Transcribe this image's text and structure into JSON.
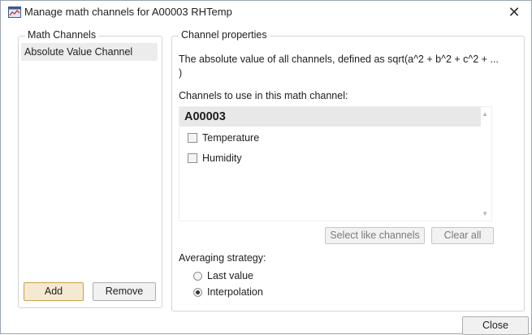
{
  "window": {
    "title": "Manage math channels for A00003 RHTemp",
    "close_glyph": "✕"
  },
  "math_channels": {
    "legend": "Math Channels",
    "items": [
      {
        "label": "Absolute Value Channel",
        "selected": true
      }
    ],
    "add_label": "Add",
    "remove_label": "Remove"
  },
  "channel_properties": {
    "legend": "Channel properties",
    "description": "The absolute value of all channels, defined as sqrt(a^2 + b^2 + c^2 + ... )",
    "channels_label": "Channels to use in this math channel:",
    "device_group": "A00003",
    "channels": [
      {
        "label": "Temperature",
        "checked": false
      },
      {
        "label": "Humidity",
        "checked": false
      }
    ],
    "select_like_label": "Select like channels",
    "clear_all_label": "Clear all",
    "averaging_label": "Averaging strategy:",
    "averaging_options": [
      {
        "label": "Last value",
        "selected": false
      },
      {
        "label": "Interpolation",
        "selected": true
      }
    ]
  },
  "footer": {
    "close_label": "Close"
  },
  "icons": {
    "app": "chart-window-icon",
    "close": "close-icon",
    "scroll_up": "scroll-up-arrow-icon",
    "scroll_down": "scroll-down-arrow-icon"
  },
  "colors": {
    "add_button_border": "#c9a24a",
    "add_button_bg": "#f5ead1",
    "selected_item_bg": "#ececec",
    "group_header_bg": "#e8e8e8"
  }
}
